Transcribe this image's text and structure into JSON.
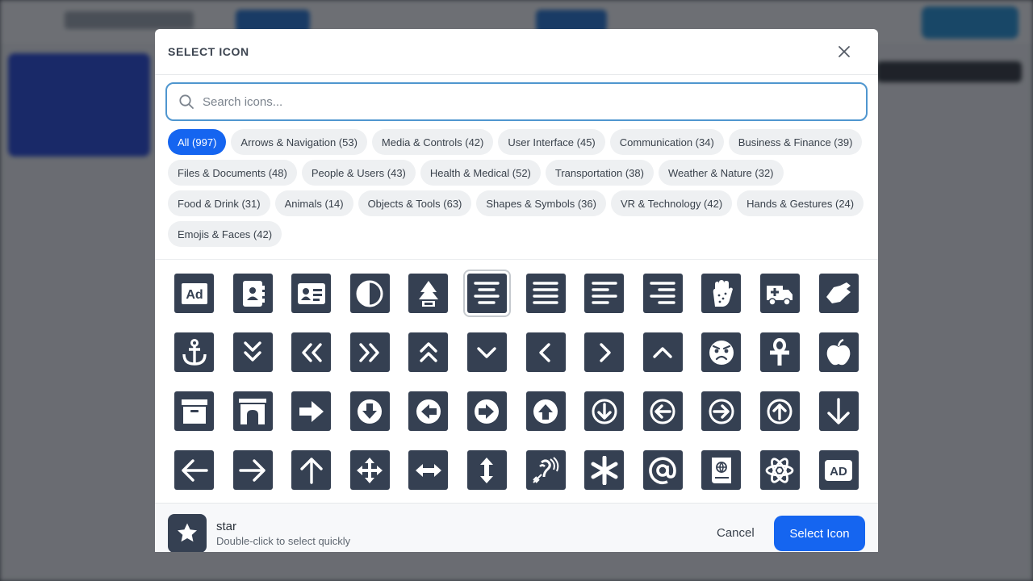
{
  "modal": {
    "title": "SELECT ICON",
    "search_placeholder": "Search icons..."
  },
  "categories": [
    {
      "label": "All (997)",
      "active": true
    },
    {
      "label": "Arrows & Navigation (53)"
    },
    {
      "label": "Media & Controls (42)"
    },
    {
      "label": "User Interface (45)"
    },
    {
      "label": "Communication (34)"
    },
    {
      "label": "Business & Finance (39)"
    },
    {
      "label": "Files & Documents (48)"
    },
    {
      "label": "People & Users (43)"
    },
    {
      "label": "Health & Medical (52)"
    },
    {
      "label": "Transportation (38)"
    },
    {
      "label": "Weather & Nature (32)"
    },
    {
      "label": "Food & Drink (31)"
    },
    {
      "label": "Animals (14)"
    },
    {
      "label": "Objects & Tools (63)"
    },
    {
      "label": "Shapes & Symbols (36)"
    },
    {
      "label": "VR & Technology (42)"
    },
    {
      "label": "Hands & Gestures (24)"
    },
    {
      "label": "Emojis & Faces (42)"
    }
  ],
  "icons": [
    "ad-icon",
    "address-book-icon",
    "address-card-icon",
    "adjust-icon",
    "air-freshener-icon",
    "align-center-icon",
    "align-justify-icon",
    "align-left-icon",
    "align-right-icon",
    "allergies-icon",
    "ambulance-icon",
    "american-sign-language-icon",
    "anchor-icon",
    "angle-double-down-icon",
    "angle-double-left-icon",
    "angle-double-right-icon",
    "angle-double-up-icon",
    "angle-down-icon",
    "angle-left-icon",
    "angle-right-icon",
    "angle-up-icon",
    "angry-icon",
    "ankh-icon",
    "apple-icon",
    "archive-icon",
    "archway-icon",
    "arrow-alt-right-icon",
    "arrow-circle-down-icon",
    "arrow-circle-left-icon",
    "arrow-circle-right-icon",
    "arrow-circle-up-icon",
    "arrow-circle-down-outline-icon",
    "arrow-circle-left-outline-icon",
    "arrow-circle-right-outline-icon",
    "arrow-circle-up-outline-icon",
    "arrow-down-icon",
    "arrow-left-icon",
    "arrow-right-icon",
    "arrow-up-icon",
    "arrows-alt-icon",
    "arrows-alt-h-icon",
    "arrows-alt-v-icon",
    "assistive-listening-icon",
    "asterisk-icon",
    "at-icon",
    "atlas-icon",
    "atom-icon",
    "audio-description-icon"
  ],
  "selected_icon_index": 5,
  "icon_labels": {
    "ad": "Ad",
    "audio_description": "AD"
  },
  "footer": {
    "selected_name": "star",
    "hint": "Double-click to select quickly",
    "cancel_label": "Cancel",
    "select_label": "Select Icon"
  },
  "colors": {
    "accent": "#1565f0",
    "tile": "#354052",
    "search_border": "#4f96cf"
  }
}
